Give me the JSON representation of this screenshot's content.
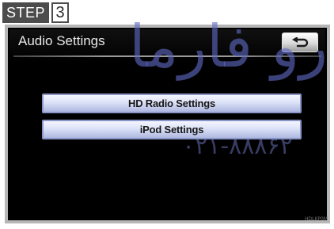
{
  "step": {
    "label": "STEP",
    "number": "3"
  },
  "screen": {
    "title": "Audio Settings",
    "back_button_icon": "back-arrow-icon",
    "menu": [
      {
        "label": "HD Radio Settings"
      },
      {
        "label": "iPod Settings"
      }
    ]
  },
  "watermark": {
    "logo_text": "ﺭﻭ ﻓﺎﺭﻣﺎ",
    "phone": "۰۲۱-۸۸۸۶۲"
  },
  "figure_code": "HDLKP0M",
  "colors": {
    "screen_bg": "#000000",
    "button_face": "#dbe1f7",
    "button_border": "#8a96c8",
    "step_badge": "#4c4c4c",
    "watermark": "#5f69c3"
  }
}
